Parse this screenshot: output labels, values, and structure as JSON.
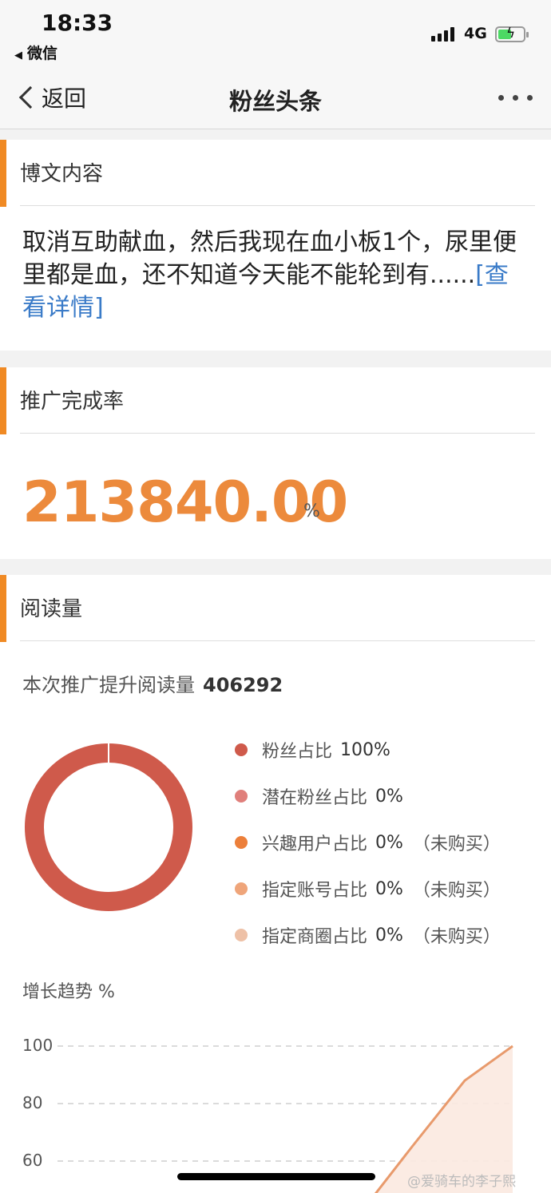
{
  "status_bar": {
    "time": "18:33",
    "back_app": "微信",
    "network": "4G"
  },
  "nav": {
    "back_label": "返回",
    "title": "粉丝头条"
  },
  "article": {
    "header": "博文内容",
    "excerpt": "取消互助献血，然后我现在血小板1个，尿里便里都是血，还不知道今天能不能轮到有......",
    "more_link": "[查看详情]"
  },
  "completion": {
    "header": "推广完成率",
    "value": "213840.00",
    "unit": "%"
  },
  "reading": {
    "header": "阅读量",
    "boost_label": "本次推广提升阅读量",
    "boost_value": "406292",
    "legend": [
      {
        "label": "粉丝占比",
        "value": "100%",
        "note": "",
        "color": "#cf5a4b"
      },
      {
        "label": "潜在粉丝占比",
        "value": "0%",
        "note": "",
        "color": "#e07f7b"
      },
      {
        "label": "兴趣用户占比",
        "value": "0%",
        "note": "（未购买）",
        "color": "#ec7f3a"
      },
      {
        "label": "指定账号占比",
        "value": "0%",
        "note": "（未购买）",
        "color": "#efa57a"
      },
      {
        "label": "指定商圈占比",
        "value": "0%",
        "note": "（未购买）",
        "color": "#eec1a7"
      }
    ],
    "trend_title": "增长趋势 %"
  },
  "chart_data": [
    {
      "type": "pie",
      "labels": [
        "粉丝占比",
        "潜在粉丝占比",
        "兴趣用户占比",
        "指定账号占比",
        "指定商圈占比"
      ],
      "values": [
        100,
        0,
        0,
        0,
        0
      ],
      "colors": [
        "#cf5a4b",
        "#e07f7b",
        "#ec7f3a",
        "#efa57a",
        "#eec1a7"
      ]
    },
    {
      "type": "area",
      "title": "增长趋势 %",
      "y_ticks": [
        "100",
        "80",
        "60"
      ],
      "points": [
        {
          "x": 0,
          "y": 45
        },
        {
          "x": 1,
          "y": 65
        },
        {
          "x": 2,
          "y": 88
        },
        {
          "x": 3,
          "y": 100
        }
      ],
      "visible_ylim": [
        58,
        100
      ],
      "grid": "dashed",
      "color": "#e89a6c"
    }
  ],
  "watermark": "@爱骑车的李子熙"
}
